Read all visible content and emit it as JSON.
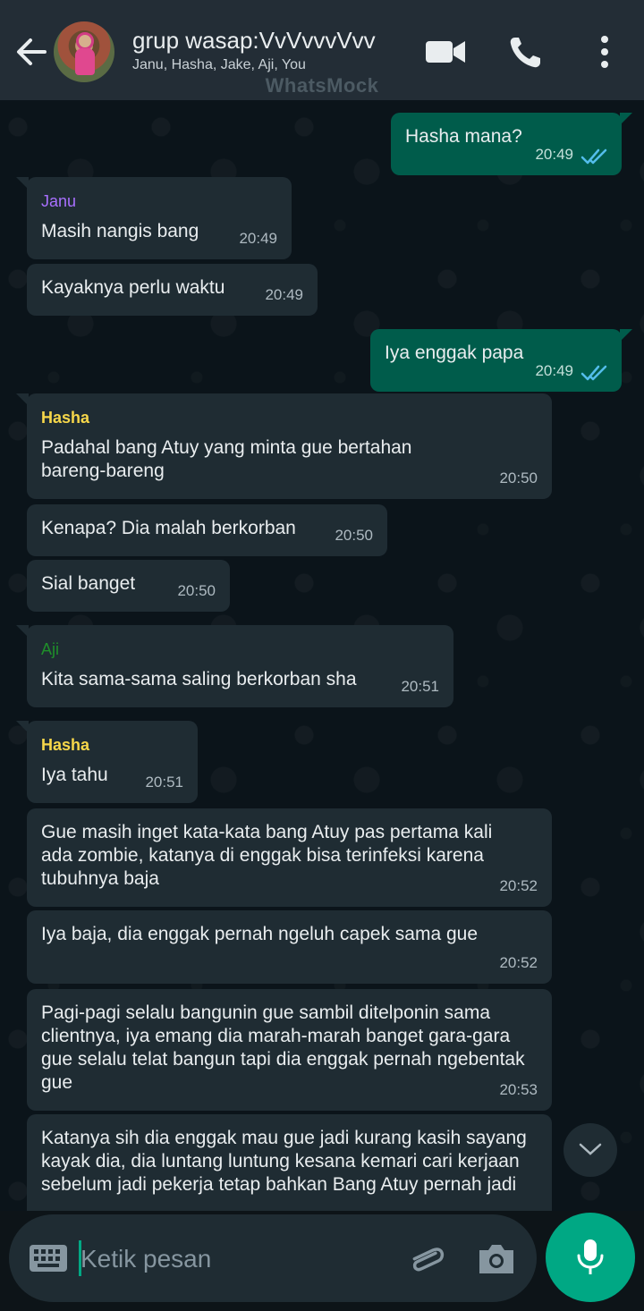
{
  "header": {
    "title": "grup wasap:VvVvvvVvv",
    "members": "Janu, Hasha, Jake, Aji, You",
    "watermark": "WhatsMock"
  },
  "messages": [
    {
      "dir": "out",
      "text": "Hasha mana?",
      "time": "20:49",
      "ticks": "read"
    },
    {
      "dir": "in",
      "sender": "Janu",
      "sender_color": "#a970ff",
      "text": "Masih nangis bang",
      "time": "20:49"
    },
    {
      "dir": "in",
      "text": "Kayaknya perlu waktu",
      "time": "20:49"
    },
    {
      "dir": "out",
      "text": "Iya enggak papa",
      "time": "20:49",
      "ticks": "read"
    },
    {
      "dir": "in",
      "sender": "Hasha",
      "sender_color": "#f7d74a",
      "text": "Padahal bang Atuy yang minta gue bertahan bareng-bareng",
      "time": "20:50"
    },
    {
      "dir": "in",
      "text": "Kenapa? Dia malah berkorban",
      "time": "20:50"
    },
    {
      "dir": "in",
      "text": "Sial banget",
      "time": "20:50"
    },
    {
      "dir": "in",
      "sender": "Aji",
      "sender_color": "#1f8f2a",
      "text": "Kita sama-sama saling berkorban sha",
      "time": "20:51"
    },
    {
      "dir": "in",
      "sender": "Hasha",
      "sender_color": "#f7d74a",
      "text": "Iya tahu",
      "time": "20:51"
    },
    {
      "dir": "in",
      "text": "Gue masih inget kata-kata bang Atuy pas pertama kali ada zombie, katanya di enggak bisa terinfeksi karena tubuhnya baja",
      "time": "20:52"
    },
    {
      "dir": "in",
      "text": "Iya baja, dia enggak pernah ngeluh capek sama gue",
      "time": "20:52"
    },
    {
      "dir": "in",
      "text": "Pagi-pagi selalu bangunin gue sambil ditelponin sama clientnya, iya emang dia marah-marah banget gara-gara gue selalu telat bangun tapi dia enggak pernah ngebentak gue",
      "time": "20:53"
    },
    {
      "dir": "in",
      "text": "Katanya sih dia enggak mau gue jadi kurang kasih sayang kayak dia, dia luntang luntung kesana kemari cari kerjaan sebelum jadi pekerja tetap bahkan Bang Atuy pernah jadi",
      "time": ""
    }
  ],
  "composer": {
    "placeholder": "Ketik pesan"
  },
  "colors": {
    "header_bg": "#232d36",
    "incoming_bubble": "#1f2c33",
    "outgoing_bubble": "#005c4b",
    "accent": "#00a884",
    "read_ticks": "#53bdeb"
  },
  "icons": [
    "back-arrow-icon",
    "video-call-icon",
    "voice-call-icon",
    "more-options-icon",
    "keyboard-icon",
    "attach-icon",
    "camera-icon",
    "mic-icon",
    "scroll-down-icon",
    "double-check-icon"
  ]
}
